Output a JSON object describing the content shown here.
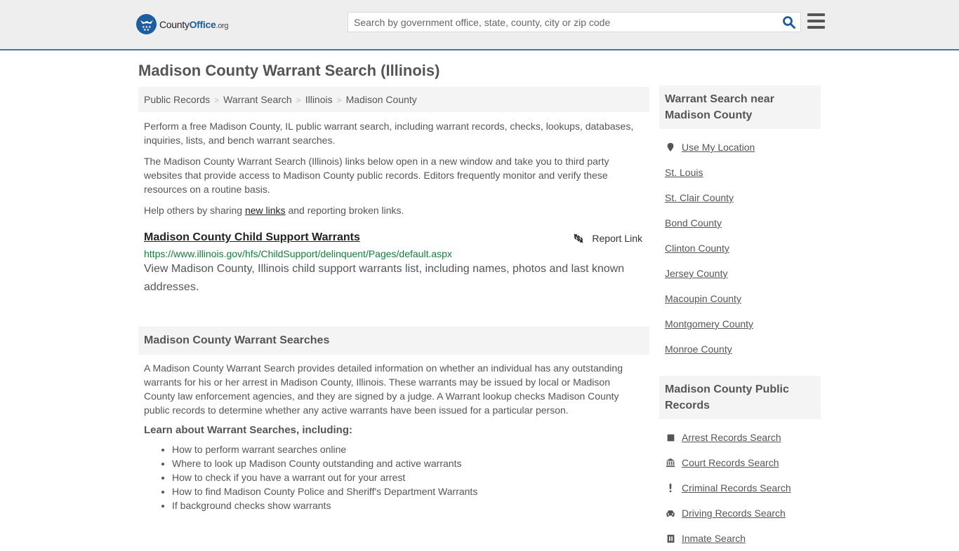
{
  "header": {
    "logo": {
      "part1": "County",
      "part2": "Office",
      "part3": ".org"
    },
    "search_placeholder": "Search by government office, state, county, city or zip code",
    "search_value": "",
    "colors": {
      "brand": "#1c5ea0",
      "border": "#3b7bb0",
      "link_green": "#1a7a3a"
    }
  },
  "page_title": "Madison County Warrant Search (Illinois)",
  "breadcrumb": {
    "items": [
      "Public Records",
      "Warrant Search",
      "Illinois",
      "Madison County"
    ],
    "separator": ">"
  },
  "intro": {
    "p1": "Perform a free Madison County, IL public warrant search, including warrant records, checks, lookups, databases, inquiries, lists, and bench warrant searches.",
    "p2": "The Madison County Warrant Search (Illinois) links below open in a new window and take you to third party websites that provide access to Madison County public records. Editors frequently monitor and verify these resources on a routine basis.",
    "p3_before": "Help others by sharing ",
    "p3_link": "new links",
    "p3_after": " and reporting broken links."
  },
  "result": {
    "title": "Madison County Child Support Warrants",
    "report_label": "Report Link",
    "url": "https://www.illinois.gov/hfs/ChildSupport/delinquent/Pages/default.aspx",
    "description": "View Madison County, Illinois child support warrants list, including names, photos and last known addresses."
  },
  "searches_section": {
    "title": "Madison County Warrant Searches",
    "body": "A Madison County Warrant Search provides detailed information on whether an individual has any outstanding warrants for his or her arrest in Madison County, Illinois. These warrants may be issued by local or Madison County law enforcement agencies, and they are signed by a judge. A Warrant lookup checks Madison County public records to determine whether any active warrants have been issued for a particular person.",
    "learn_title": "Learn about Warrant Searches, including:",
    "learn_items": [
      "How to perform warrant searches online",
      "Where to look up Madison County outstanding and active warrants",
      "How to check if you have a warrant out for your arrest",
      "How to find Madison County Police and Sheriff's Department Warrants",
      "If background checks show warrants"
    ]
  },
  "sidebar": {
    "nearby": {
      "title": "Warrant Search near Madison County",
      "use_location": {
        "label": "Use My Location",
        "icon": "map-marker-icon"
      },
      "items": [
        "St. Louis",
        "St. Clair County",
        "Bond County",
        "Clinton County",
        "Jersey County",
        "Macoupin County",
        "Montgomery County",
        "Monroe County"
      ]
    },
    "public_records": {
      "title": "Madison County Public Records",
      "items": [
        {
          "label": "Arrest Records Search",
          "icon": "book-icon"
        },
        {
          "label": "Court Records Search",
          "icon": "courthouse-icon"
        },
        {
          "label": "Criminal Records Search",
          "icon": "exclamation-icon"
        },
        {
          "label": "Driving Records Search",
          "icon": "car-icon"
        },
        {
          "label": "Inmate Search",
          "icon": "jail-icon"
        }
      ]
    }
  }
}
